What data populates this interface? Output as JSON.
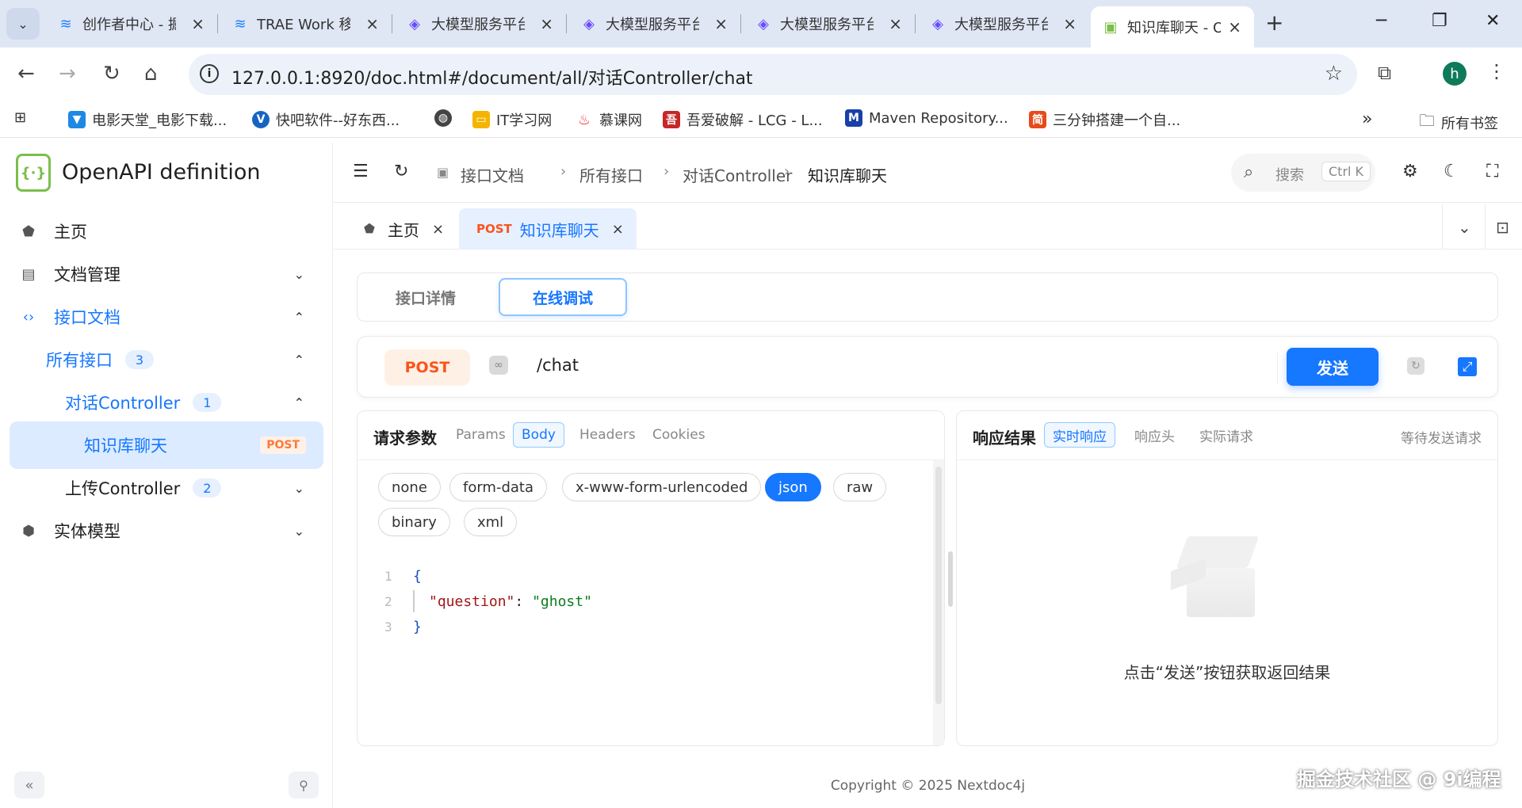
{
  "browser": {
    "tabs": [
      {
        "title": "创作者中心 - 掘",
        "icon": "juejin-icon"
      },
      {
        "title": "TRAE Work 移",
        "icon": "juejin-icon"
      },
      {
        "title": "大模型服务平台",
        "icon": "cube-icon"
      },
      {
        "title": "大模型服务平台",
        "icon": "cube-icon"
      },
      {
        "title": "大模型服务平台",
        "icon": "cube-icon"
      },
      {
        "title": "大模型服务平台",
        "icon": "cube-icon"
      },
      {
        "title": "知识库聊天 - O",
        "icon": "openapi-icon"
      }
    ],
    "url": "127.0.0.1:8920/doc.html#/document/all/对话Controller/chat",
    "profile_initial": "h",
    "bookmarks": [
      {
        "label": "电影天堂_电影下载...",
        "color": "#1e88e5"
      },
      {
        "label": "快吧软件--好东西...",
        "color": "#1565c0"
      },
      {
        "label": "",
        "color": "#333333"
      },
      {
        "label": "IT学习网",
        "color": "#f4b400"
      },
      {
        "label": "慕课网",
        "color": "#e53935"
      },
      {
        "label": "吾爱破解 - LCG - L...",
        "color": "#c62828"
      },
      {
        "label": "Maven Repository...",
        "color": "#1a3fa8"
      },
      {
        "label": "三分钟搭建一个自...",
        "color": "#e64a19"
      }
    ],
    "all_bookmarks": "所有书签"
  },
  "sidebar": {
    "app_title": "OpenAPI definition",
    "items": [
      {
        "label": "主页"
      },
      {
        "label": "文档管理"
      },
      {
        "label": "接口文档"
      },
      {
        "label": "所有接口",
        "count": "3"
      },
      {
        "label": "对话Controller",
        "count": "1"
      },
      {
        "label": "知识库聊天",
        "method": "POST"
      },
      {
        "label": "上传Controller",
        "count": "2"
      },
      {
        "label": "实体模型"
      }
    ]
  },
  "header": {
    "breadcrumb": [
      "接口文档",
      "所有接口",
      "对话Controller",
      "知识库聊天"
    ],
    "search_placeholder": "搜索",
    "search_shortcut": "Ctrl K"
  },
  "page_tabs": [
    {
      "label": "主页"
    },
    {
      "label": "知识库聊天",
      "method": "POST"
    }
  ],
  "modes": [
    "接口详情",
    "在线调试"
  ],
  "request": {
    "method": "POST",
    "path": "/chat",
    "send_label": "发送",
    "params_title": "请求参数",
    "param_tabs": [
      "Params",
      "Body",
      "Headers",
      "Cookies"
    ],
    "body_types": [
      "none",
      "form-data",
      "x-www-form-urlencoded",
      "json",
      "raw",
      "binary",
      "xml"
    ],
    "selected_body_type": "json",
    "code_lines": [
      {
        "no": "1",
        "open": "{"
      },
      {
        "no": "2",
        "key": "\"question\"",
        "colon": ": ",
        "value": "\"ghost\""
      },
      {
        "no": "3",
        "close": "}"
      }
    ]
  },
  "response": {
    "title": "响应结果",
    "tabs": [
      "实时响应",
      "响应头",
      "实际请求"
    ],
    "status": "等待发送请求",
    "empty_text": "点击“发送”按钮获取返回结果"
  },
  "footer": "Copyright © 2025 Nextdoc4j",
  "watermark": "掘金技术社区 @ 9i编程",
  "colors": {
    "accent": "#1677ff",
    "post": "#fa541c"
  }
}
